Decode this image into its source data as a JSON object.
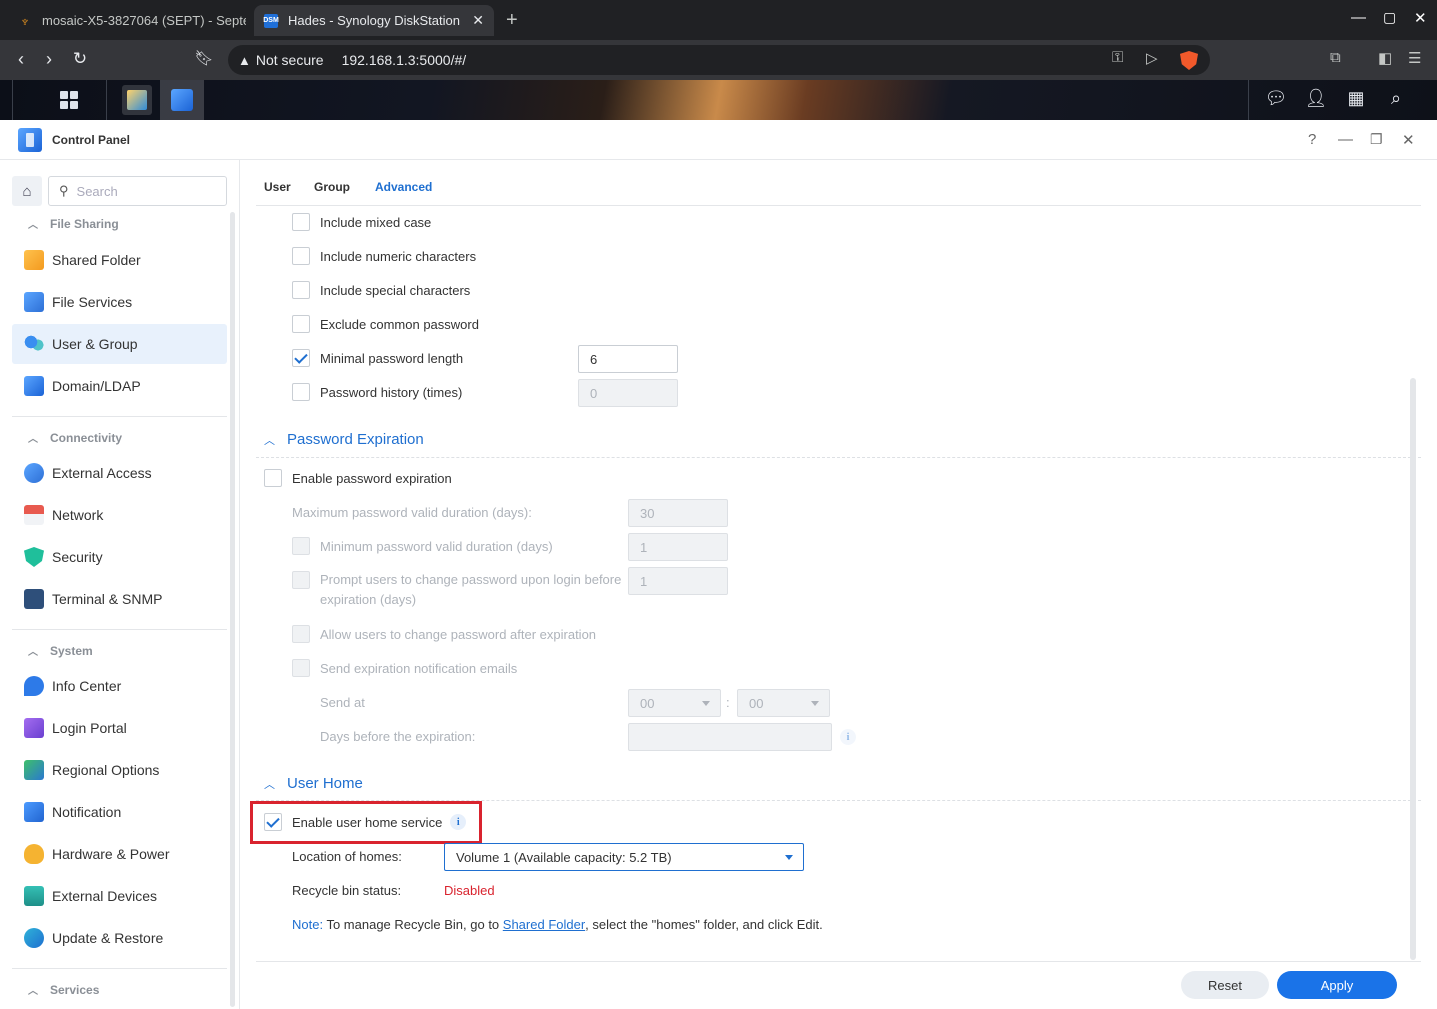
{
  "browser": {
    "tabs": [
      {
        "title": "mosaic-X5-3827064 (SEPT) - Septe",
        "favicon": "brave-lion-icon"
      },
      {
        "title": "Hades - Synology DiskStation",
        "favicon": "dsm-icon",
        "active": true
      }
    ],
    "address": {
      "security_label": "Not secure",
      "url": "192.168.1.3:5000/#/"
    },
    "dsm_favicon_text": "DSM"
  },
  "window": {
    "title": "Control Panel"
  },
  "sidebar": {
    "search_placeholder": "Search",
    "sections": [
      {
        "title": "File Sharing",
        "items": [
          "Shared Folder",
          "File Services",
          "User & Group",
          "Domain/LDAP"
        ]
      },
      {
        "title": "Connectivity",
        "items": [
          "External Access",
          "Network",
          "Security",
          "Terminal & SNMP"
        ]
      },
      {
        "title": "System",
        "items": [
          "Info Center",
          "Login Portal",
          "Regional Options",
          "Notification",
          "Hardware & Power",
          "External Devices",
          "Update & Restore"
        ]
      },
      {
        "title": "Services",
        "items": []
      }
    ],
    "active_item": "User & Group"
  },
  "tabs": [
    "User",
    "Group",
    "Advanced"
  ],
  "active_tab": "Advanced",
  "password_rules": [
    {
      "label": "Include mixed case",
      "checked": false
    },
    {
      "label": "Include numeric characters",
      "checked": false
    },
    {
      "label": "Include special characters",
      "checked": false
    },
    {
      "label": "Exclude common password",
      "checked": false
    },
    {
      "label": "Minimal password length",
      "checked": true,
      "value": "6"
    },
    {
      "label": "Password history (times)",
      "checked": false,
      "value": "0"
    }
  ],
  "password_expiration": {
    "title": "Password Expiration",
    "enable_label": "Enable password expiration",
    "max_label": "Maximum password valid duration (days):",
    "max_value": "30",
    "min_label": "Minimum password valid duration (days)",
    "min_value": "1",
    "prompt_label_1": "Prompt users to change password upon login before",
    "prompt_label_2": "expiration (days)",
    "prompt_value": "1",
    "allow_label": "Allow users to change password after expiration",
    "send_label": "Send expiration notification emails",
    "send_at_label": "Send at",
    "hour": "00",
    "minute": "00",
    "time_sep": ":",
    "days_before_label": "Days before the expiration:",
    "days_before_value": ""
  },
  "user_home": {
    "title": "User Home",
    "enable_label": "Enable user home service",
    "enabled": true,
    "location_label": "Location of homes:",
    "location_value": "Volume 1 (Available capacity:  5.2 TB)",
    "recycle_label": "Recycle bin status:",
    "recycle_value": "Disabled",
    "note_prefix": "Note:",
    "note_text_1": " To manage Recycle Bin, go to ",
    "note_link": "Shared Folder",
    "note_text_2": ", select the \"homes\" folder, and click Edit."
  },
  "buttons": {
    "reset": "Reset",
    "apply": "Apply"
  },
  "colors": {
    "accent": "#1f6fd0",
    "apply_button": "#1a73e8",
    "disabled_text": "#d9232e",
    "highlight_box": "#d9232e"
  }
}
